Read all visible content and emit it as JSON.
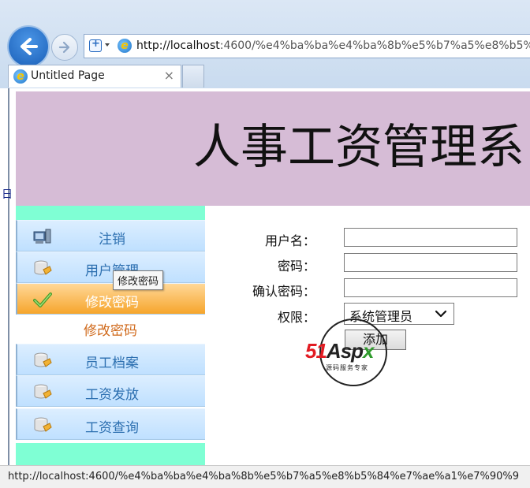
{
  "browser": {
    "url_host": "http://localhost",
    "url_rest": ":4600/%e4%ba%ba%e4%ba%8b%e5%b7%a5%e8%b5%8",
    "tab_title": "Untitled Page",
    "tab_close": "×",
    "status_url": "http://localhost:4600/%e4%ba%ba%e4%ba%8b%e5%b7%a5%e8%b5%84%e7%ae%a1%e7%90%9"
  },
  "banner": {
    "title": "人事工资管理系",
    "day_fragment": "日"
  },
  "sidebar": {
    "items": [
      {
        "label": "注销",
        "icon": "computer-icon"
      },
      {
        "label": "用户管理",
        "icon": "database-icon"
      },
      {
        "label": "修改密码",
        "icon": "check-icon",
        "active": true
      },
      {
        "label": "员工档案",
        "icon": "database-icon"
      },
      {
        "label": "工资发放",
        "icon": "database-icon"
      },
      {
        "label": "工资查询",
        "icon": "database-icon"
      }
    ],
    "sub_item": "修改密码",
    "tooltip": "修改密码"
  },
  "form": {
    "username_label": "用户名：",
    "password_label": "密码：",
    "confirm_label": "确认密码：",
    "role_label": "权限：",
    "role_value": "系统管理员",
    "add_button": "添加"
  },
  "watermark": {
    "brand_red": "51",
    "brand_dark": "Asp",
    "brand_green": "x",
    "tagline": "源码服务专家"
  },
  "colors": {
    "banner": "#d6bcd6",
    "sidebar_accent": "#7fffd4",
    "menu_active": "#f6a52c",
    "menu_text": "#2c6fb0",
    "sub_item_text": "#d06a1c"
  }
}
